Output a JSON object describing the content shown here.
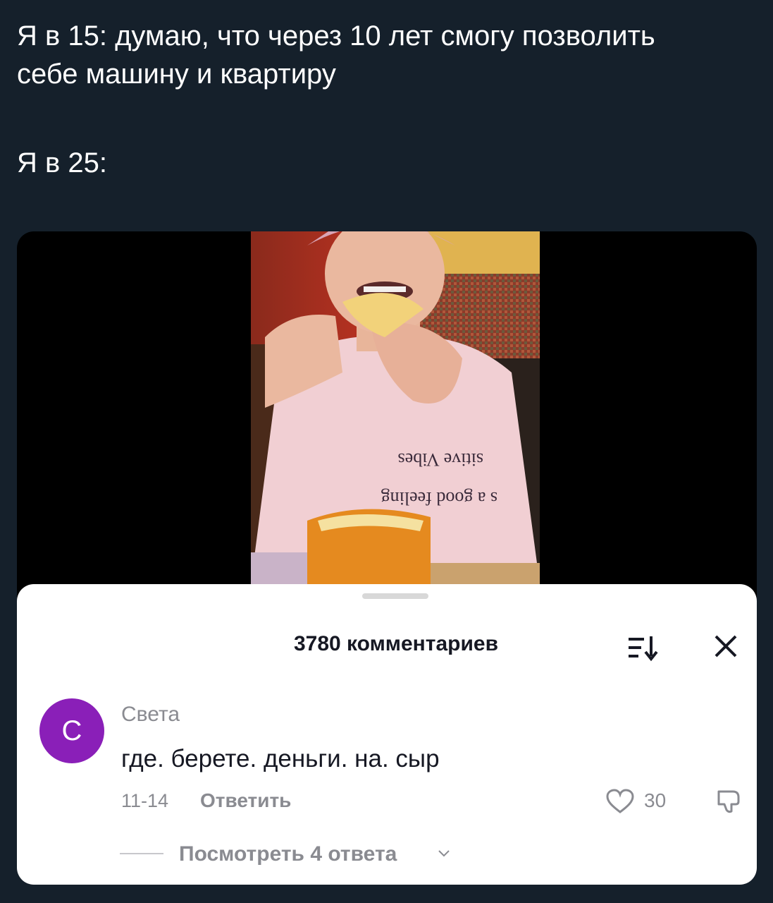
{
  "post": {
    "line1": "Я в 15: думаю, что через 10 лет смогу позволить",
    "line2": "себе машину и квартиру",
    "line3": "Я в 25:"
  },
  "video": {
    "shirt_text_line1": "sitive Vibes",
    "shirt_text_line2": "s a good feeling"
  },
  "comments_panel": {
    "count_label": "3780 комментариев",
    "sort_icon": "sort-icon",
    "close_icon": "close-icon"
  },
  "comment": {
    "avatar_letter": "С",
    "avatar_color": "#8a1fb8",
    "author": "Света",
    "text": "где. берете. деньги. на. сыр",
    "date": "11-14",
    "reply_label": "Ответить",
    "like_count": "30",
    "view_replies": "Посмотреть 4 ответа"
  }
}
